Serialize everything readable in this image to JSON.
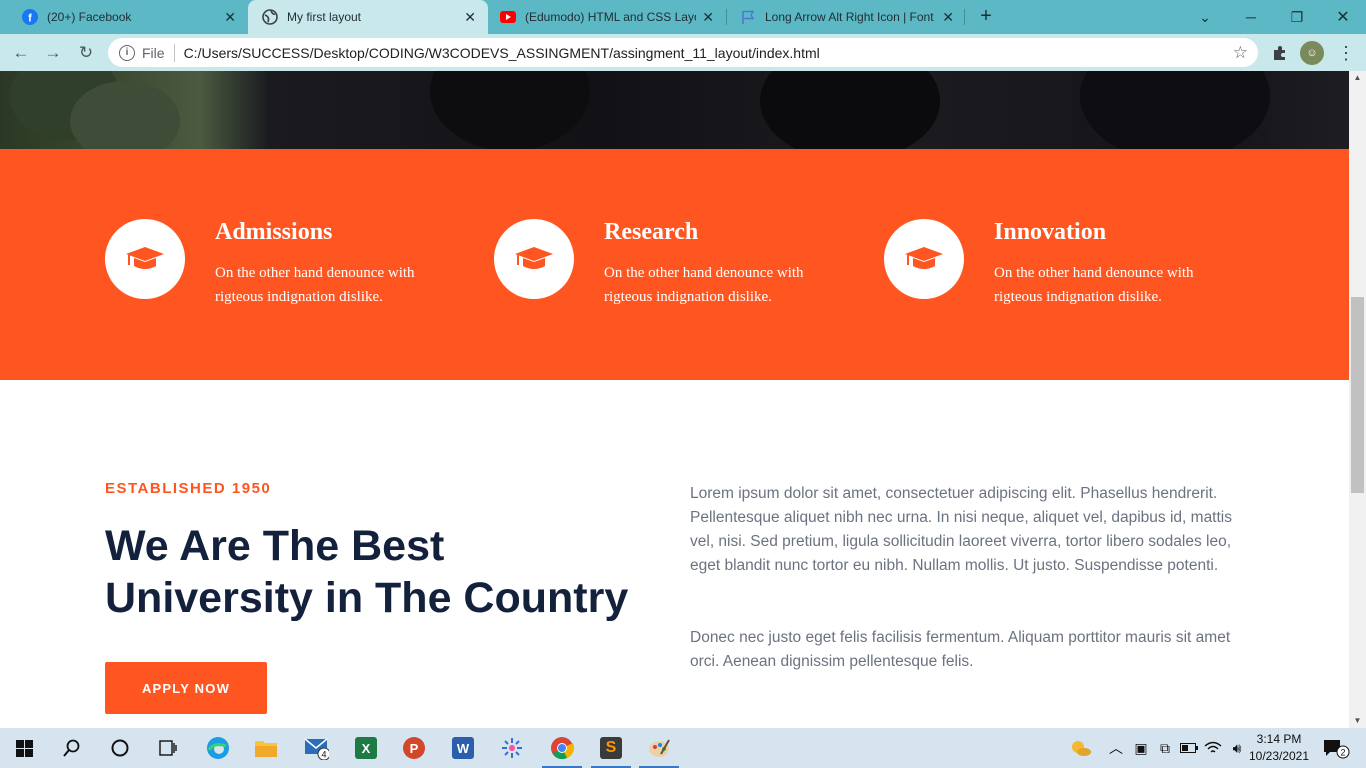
{
  "browser": {
    "tabs": [
      {
        "title": "(20+) Facebook",
        "icon": "facebook-icon",
        "active": false
      },
      {
        "title": "My first layout",
        "icon": "globe-icon",
        "active": true
      },
      {
        "title": "(Edumodo) HTML and CSS Layou",
        "icon": "youtube-icon",
        "active": false
      },
      {
        "title": "Long Arrow Alt Right Icon | Font",
        "icon": "flag-icon",
        "active": false
      }
    ],
    "address": {
      "scheme_label": "File",
      "url": "C:/Users/SUCCESS/Desktop/CODING/W3CODEVS_ASSINGMENT/assingment_11_layout/index.html"
    }
  },
  "features": [
    {
      "title": "Admissions",
      "text": "On the other hand denounce with rigteous indignation dislike.",
      "icon": "graduation-cap-icon"
    },
    {
      "title": "Research",
      "text": "On the other hand denounce with rigteous indignation dislike.",
      "icon": "graduation-cap-icon"
    },
    {
      "title": "Innovation",
      "text": "On the other hand denounce with rigteous indignation dislike.",
      "icon": "graduation-cap-icon"
    }
  ],
  "about": {
    "eyebrow": "ESTABLISHED 1950",
    "headline_line1": "We Are The Best",
    "headline_line2": "University in The Country",
    "apply_label": "APPLY NOW",
    "paragraph1": "Lorem ipsum dolor sit amet, consectetuer adipiscing elit. Phasellus hendrerit. Pellentesque aliquet nibh nec urna. In nisi neque, aliquet vel, dapibus id, mattis vel, nisi. Sed pretium, ligula sollicitudin laoreet viverra, tortor libero sodales leo, eget blandit nunc tortor eu nibh. Nullam mollis. Ut justo. Suspendisse potenti.",
    "paragraph2": "Donec nec justo eget felis facilisis fermentum. Aliquam porttitor mauris sit amet orci. Aenean dignissim pellentesque felis."
  },
  "colors": {
    "accent": "#ff5621",
    "heading": "#13213c",
    "body_text": "#6b7280",
    "tab_strip": "#5cb8c4"
  },
  "taskbar": {
    "mail_badge": "4",
    "time": "3:14 PM",
    "date": "10/23/2021",
    "notifications": "2"
  }
}
